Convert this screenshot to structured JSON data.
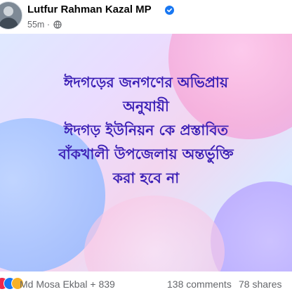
{
  "post": {
    "author": "Lutfur Rahman Kazal MP",
    "time": "55m",
    "separator": "·",
    "lines": [
      "ঈদগড়ের জনগণের অভিপ্রায়",
      "অনুযায়ী",
      "ঈদগড় ইউনিয়ন কে প্রস্তাবিত",
      "বাঁকখালী উপজেলায় অন্তর্ভুক্তি",
      "করা হবে না"
    ]
  },
  "footer": {
    "reactors": "Md Mosa Ekbal + 839",
    "comments": "138 comments",
    "shares": "78 shares"
  },
  "colors": {
    "text_accent": "#3b1fb5",
    "verified": "#1877f2"
  },
  "icons": [
    "verified-badge-icon",
    "globe-icon",
    "love-react-icon",
    "like-react-icon",
    "haha-react-icon"
  ]
}
